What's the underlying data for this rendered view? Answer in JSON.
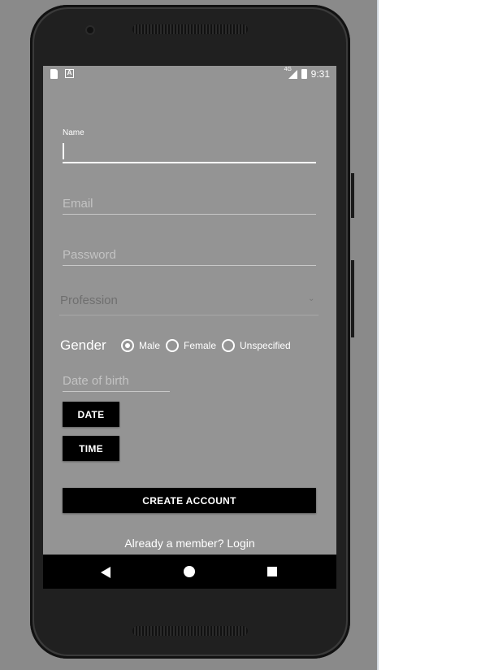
{
  "status_bar": {
    "time": "9:31",
    "network": "4G",
    "notif_icon_a": "A"
  },
  "form": {
    "name": {
      "label": "Name",
      "value": ""
    },
    "email": {
      "placeholder": "Email"
    },
    "password": {
      "placeholder": "Password"
    },
    "profession": {
      "placeholder": "Profession"
    },
    "gender": {
      "label": "Gender",
      "options": [
        "Male",
        "Female",
        "Unspecified"
      ],
      "selected": "Male"
    },
    "dob": {
      "placeholder": "Date of birth"
    },
    "date_button": "DATE",
    "time_button": "TIME",
    "create_button": "CREATE ACCOUNT",
    "login_link": "Already a member? Login"
  },
  "icons": {
    "nav_back": "back-triangle-icon",
    "nav_home": "home-circle-icon",
    "nav_recent": "recents-square-icon",
    "spinner": "chevron-down-icon"
  },
  "colors": {
    "screen_bg": "#949494",
    "button_bg": "#000000",
    "button_text": "#ffffff"
  }
}
